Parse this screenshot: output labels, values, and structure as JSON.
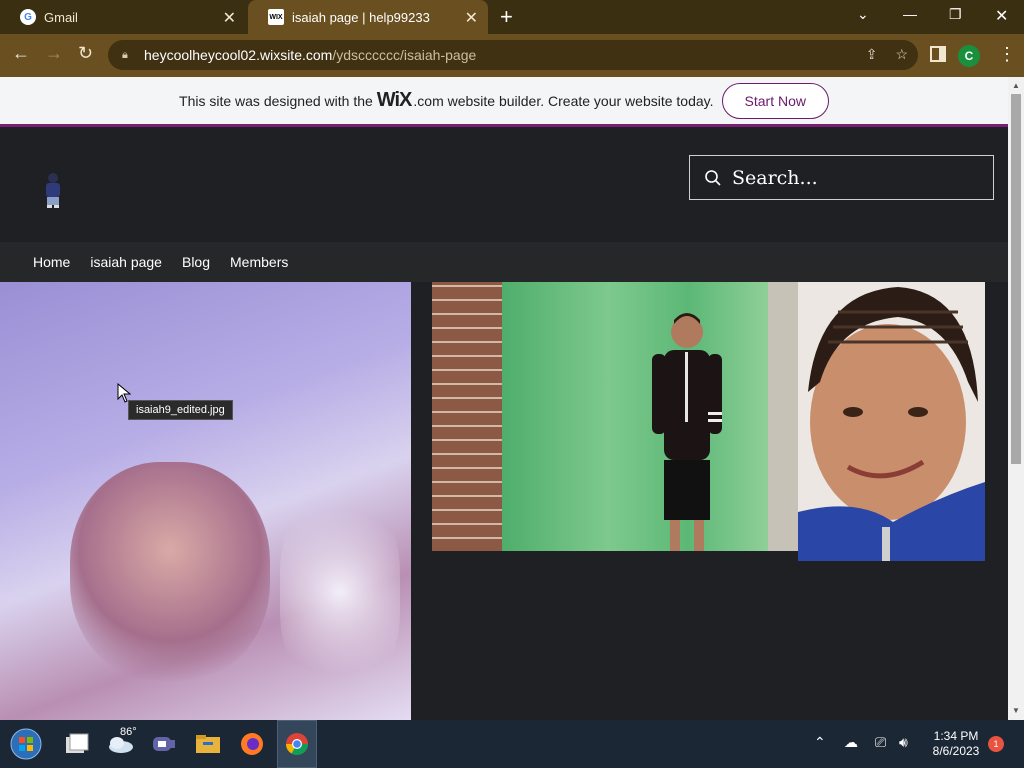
{
  "browser": {
    "tabs": [
      {
        "title": "Gmail",
        "icon": "google-icon",
        "active": false
      },
      {
        "title": "isaiah page | help99233",
        "icon": "wix-icon",
        "active": true
      }
    ],
    "url_host": "heycoolheycool02.wixsite.com",
    "url_path": "/ydscccccc/isaiah-page",
    "profile_initial": "C"
  },
  "wix_banner": {
    "text_before": "This site was designed with the",
    "logo": "WiX",
    "text_after": ".com website builder. Create your website today.",
    "button": "Start Now"
  },
  "site": {
    "search_placeholder": "Search...",
    "nav": [
      "Home",
      "isaiah page",
      "Blog",
      "Members"
    ],
    "tooltip": "isaiah9_edited.jpg"
  },
  "taskbar": {
    "weather_temp": "86°",
    "time": "1:34 PM",
    "date": "8/6/2023",
    "notification_count": "1"
  }
}
